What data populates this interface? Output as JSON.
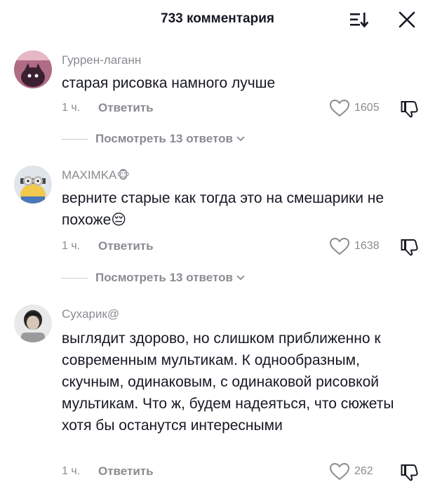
{
  "header": {
    "title": "733 комментария"
  },
  "comments": [
    {
      "username": "Гуррен-лаганн",
      "username_emoji": "",
      "text": "старая рисовка намного лучше",
      "time": "1 ч.",
      "reply_label": "Ответить",
      "likes": "1605",
      "view_replies": "Посмотреть 13 ответов"
    },
    {
      "username": "MAXIMKA",
      "username_emoji": "🐵",
      "text": "верните старые как тогда это на смешарики не похоже😔",
      "time": "1 ч.",
      "reply_label": "Ответить",
      "likes": "1638",
      "view_replies": "Посмотреть 13 ответов"
    },
    {
      "username": "Сухарик@",
      "username_emoji": "",
      "text": "выглядит здорово, но слишком приближенно к современным мультикам. К однообразным, скучным, одинаковым, с одинаковой рисовкой мультикам. Что ж, будем надеяться, что сюжеты хотя бы останутся интересными",
      "time": "1 ч.",
      "reply_label": "Ответить",
      "likes": "262"
    }
  ],
  "colors": {
    "text": "#161823",
    "muted": "#8a8b91",
    "divider": "#c9cacf"
  },
  "icons": [
    "sort-icon",
    "close-icon",
    "heart-icon",
    "dislike-icon",
    "chevron-down-icon"
  ]
}
